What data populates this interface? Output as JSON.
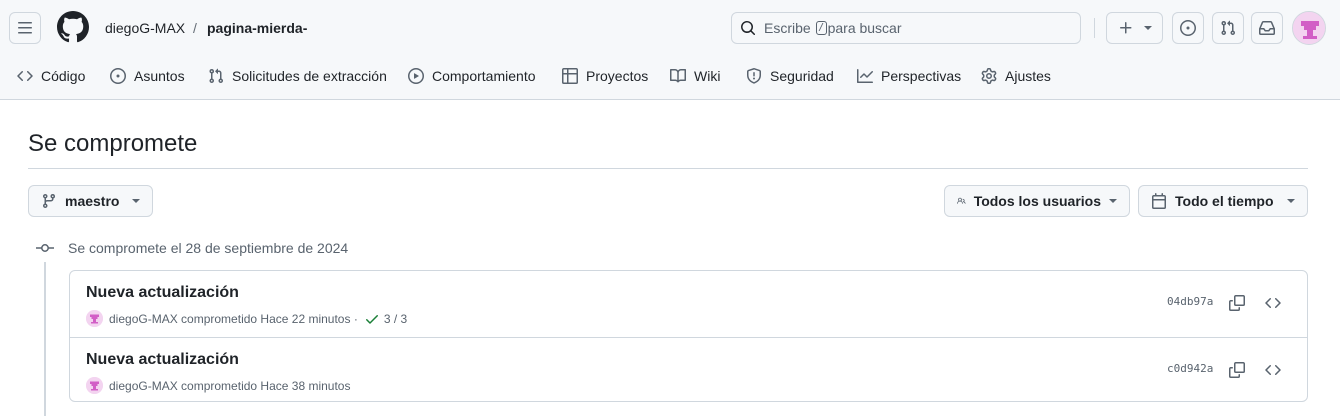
{
  "colors": {
    "accent_success": "#1a7f37",
    "avatar_pink": "#e178d8",
    "header_bg": "#f6f8fa",
    "border": "#d0d7de"
  },
  "header": {
    "owner": "diegoG-MAX",
    "separator": "/",
    "repo": "pagina-mierda-",
    "search": {
      "text_before": "Escribe",
      "key": "/",
      "text_after": "para buscar"
    },
    "icons": [
      "hamburger-icon",
      "github-logo-icon",
      "search-icon",
      "plus-icon",
      "issue-icon",
      "pull-request-icon",
      "inbox-icon",
      "avatar"
    ]
  },
  "nav": {
    "items": [
      {
        "label": "Código",
        "icon": "code-icon"
      },
      {
        "label": "Asuntos",
        "icon": "issue-opened-icon"
      },
      {
        "label": "Solicitudes de extracción",
        "icon": "git-pull-request-icon"
      },
      {
        "label": "Comportamiento",
        "icon": "play-icon"
      },
      {
        "label": "Proyectos",
        "icon": "table-icon"
      },
      {
        "label": "Wiki",
        "icon": "book-icon"
      },
      {
        "label": "Seguridad",
        "icon": "shield-icon"
      },
      {
        "label": "Perspectivas",
        "icon": "graph-icon"
      },
      {
        "label": "Ajustes",
        "icon": "gear-icon"
      }
    ]
  },
  "page": {
    "title": "Se compromete"
  },
  "filters": {
    "branch": "maestro",
    "users": "Todos los usuarios",
    "time": "Todo el tiempo"
  },
  "commit_group": {
    "label": "Se compromete el 28 de septiembre de 2024",
    "commits": [
      {
        "title": "Nueva actualización",
        "author": "diegoG-MAX",
        "verb": "comprometido",
        "time": "Hace 22 minutos",
        "dot": "·",
        "checks": "3 / 3",
        "sha": "04db97a"
      },
      {
        "title": "Nueva actualización",
        "author": "diegoG-MAX",
        "verb": "comprometido",
        "time": "Hace 38 minutos",
        "sha": "c0d942a"
      }
    ]
  }
}
